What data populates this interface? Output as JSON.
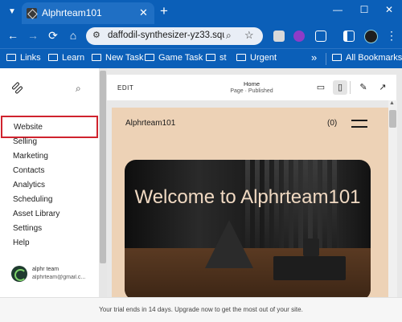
{
  "browser": {
    "tab": {
      "title": "Alphrteam101",
      "close": "✕"
    },
    "new_tab": "+",
    "window_controls": {
      "minimize": "—",
      "maximize": "☐",
      "close": "✕"
    },
    "address": {
      "url": "daffodil-synthesizer-yz33.squ..."
    },
    "bookmarks": [
      "Links",
      "Learn",
      "New Task",
      "Game Task",
      "st",
      "Urgent"
    ],
    "bookmarks_more": "»",
    "all_bookmarks": "All Bookmarks",
    "colors": {
      "frame": "#0b5fb8",
      "accent": "#d0232e"
    }
  },
  "sidebar": {
    "active_item": "Website",
    "items": [
      "Selling",
      "Marketing",
      "Contacts",
      "Analytics",
      "Scheduling",
      "Asset Library",
      "Settings",
      "Help"
    ],
    "user": {
      "name": "alphr team",
      "email": "alphrteam@gmail.c..."
    }
  },
  "editor": {
    "edit_label": "EDIT",
    "page_name": "Home",
    "page_status": "Page · Published",
    "view_modes": [
      "desktop-icon",
      "mobile-icon"
    ],
    "selected_view": "mobile-icon"
  },
  "site": {
    "title": "Alphrteam101",
    "cart": "(0)",
    "hero_heading": "Welcome to Alphrteam101",
    "colors": {
      "background": "#edd2b6",
      "heading": "#f0d9c2"
    }
  },
  "trial_banner": "Your trial ends in 14 days. Upgrade now to get the most out of your site."
}
